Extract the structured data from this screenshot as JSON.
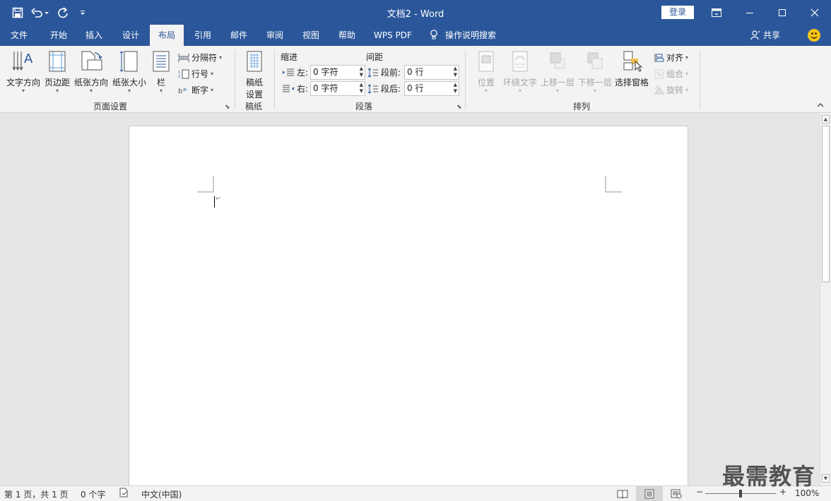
{
  "window": {
    "title": "文档2  -  Word",
    "login_label": "登录"
  },
  "tabs": [
    {
      "label": "文件"
    },
    {
      "label": "开始"
    },
    {
      "label": "插入"
    },
    {
      "label": "设计"
    },
    {
      "label": "布局"
    },
    {
      "label": "引用"
    },
    {
      "label": "邮件"
    },
    {
      "label": "审阅"
    },
    {
      "label": "视图"
    },
    {
      "label": "帮助"
    },
    {
      "label": "WPS PDF"
    },
    {
      "label": "操作说明搜索"
    }
  ],
  "share_label": "共享",
  "ribbon": {
    "page_setup": {
      "group_label": "页面设置",
      "text_direction": "文字方向",
      "margins": "页边距",
      "orientation": "纸张方向",
      "size": "纸张大小",
      "columns": "栏",
      "breaks": "分隔符",
      "line_numbers": "行号",
      "hyphenation": "断字"
    },
    "manuscript": {
      "group_label": "稿纸",
      "button_line1": "稿纸",
      "button_line2": "设置"
    },
    "paragraph": {
      "group_label": "段落",
      "indent_title": "缩进",
      "spacing_title": "间距",
      "left_label": "左:",
      "right_label": "右:",
      "before_label": "段前:",
      "after_label": "段后:",
      "left_value": "0 字符",
      "right_value": "0 字符",
      "before_value": "0 行",
      "after_value": "0 行"
    },
    "arrange": {
      "group_label": "排列",
      "position": "位置",
      "wrap_text": "环绕文字",
      "bring_forward": "上移一层",
      "send_backward": "下移一层",
      "selection_pane": "选择窗格",
      "align": "对齐",
      "group": "组合",
      "rotate": "旋转"
    }
  },
  "status": {
    "page": "第 1 页，共 1 页",
    "words": "0 个字",
    "language": "中文(中国)",
    "zoom": "100%",
    "zoom_minus": "−",
    "zoom_plus": "+"
  },
  "watermark": "最需教育"
}
